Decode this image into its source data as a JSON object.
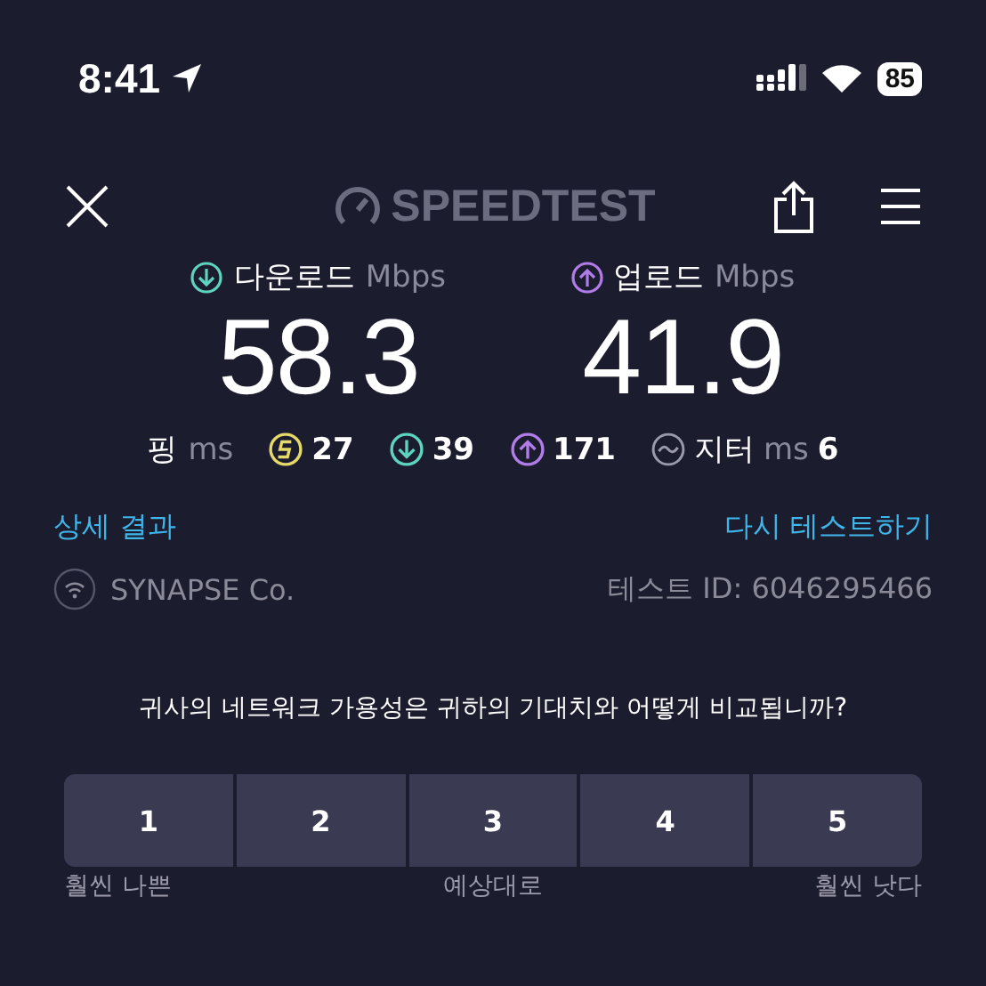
{
  "status_bar": {
    "time": "8:41",
    "battery": "85"
  },
  "header": {
    "logo": "SPEEDTEST"
  },
  "metrics": [
    {
      "kind": "download",
      "label": "다운로드",
      "unit": "Mbps",
      "value": "58.3",
      "color": "#5ed3c0"
    },
    {
      "kind": "upload",
      "label": "업로드",
      "unit": "Mbps",
      "value": "41.9",
      "color": "#b07ce8"
    }
  ],
  "ping": {
    "label": "핑",
    "unit": "ms",
    "values": [
      {
        "kind": "idle",
        "value": "27",
        "color": "#e5d96a"
      },
      {
        "kind": "download",
        "value": "39",
        "color": "#5ed3c0"
      },
      {
        "kind": "upload",
        "value": "171",
        "color": "#b07ce8"
      }
    ]
  },
  "jitter": {
    "label": "지터",
    "unit": "ms",
    "value": "6"
  },
  "links": {
    "details": "상세 결과",
    "retest": "다시 테스트하기"
  },
  "provider": {
    "name": "SYNAPSE Co.",
    "test_id": "테스트 ID: 6046295466"
  },
  "survey": {
    "question": "귀사의 네트워크 가용성은 귀하의 기대치와 어떻게 비교됩니까?",
    "options": [
      {
        "label": "1",
        "selected": false
      },
      {
        "label": "2",
        "selected": false
      },
      {
        "label": "3",
        "selected": false
      },
      {
        "label": "4",
        "selected": false
      },
      {
        "label": "5",
        "selected": false
      }
    ],
    "scale_labels": [
      "훨씬 나쁜",
      "예상대로",
      "훨씬 낫다"
    ]
  }
}
